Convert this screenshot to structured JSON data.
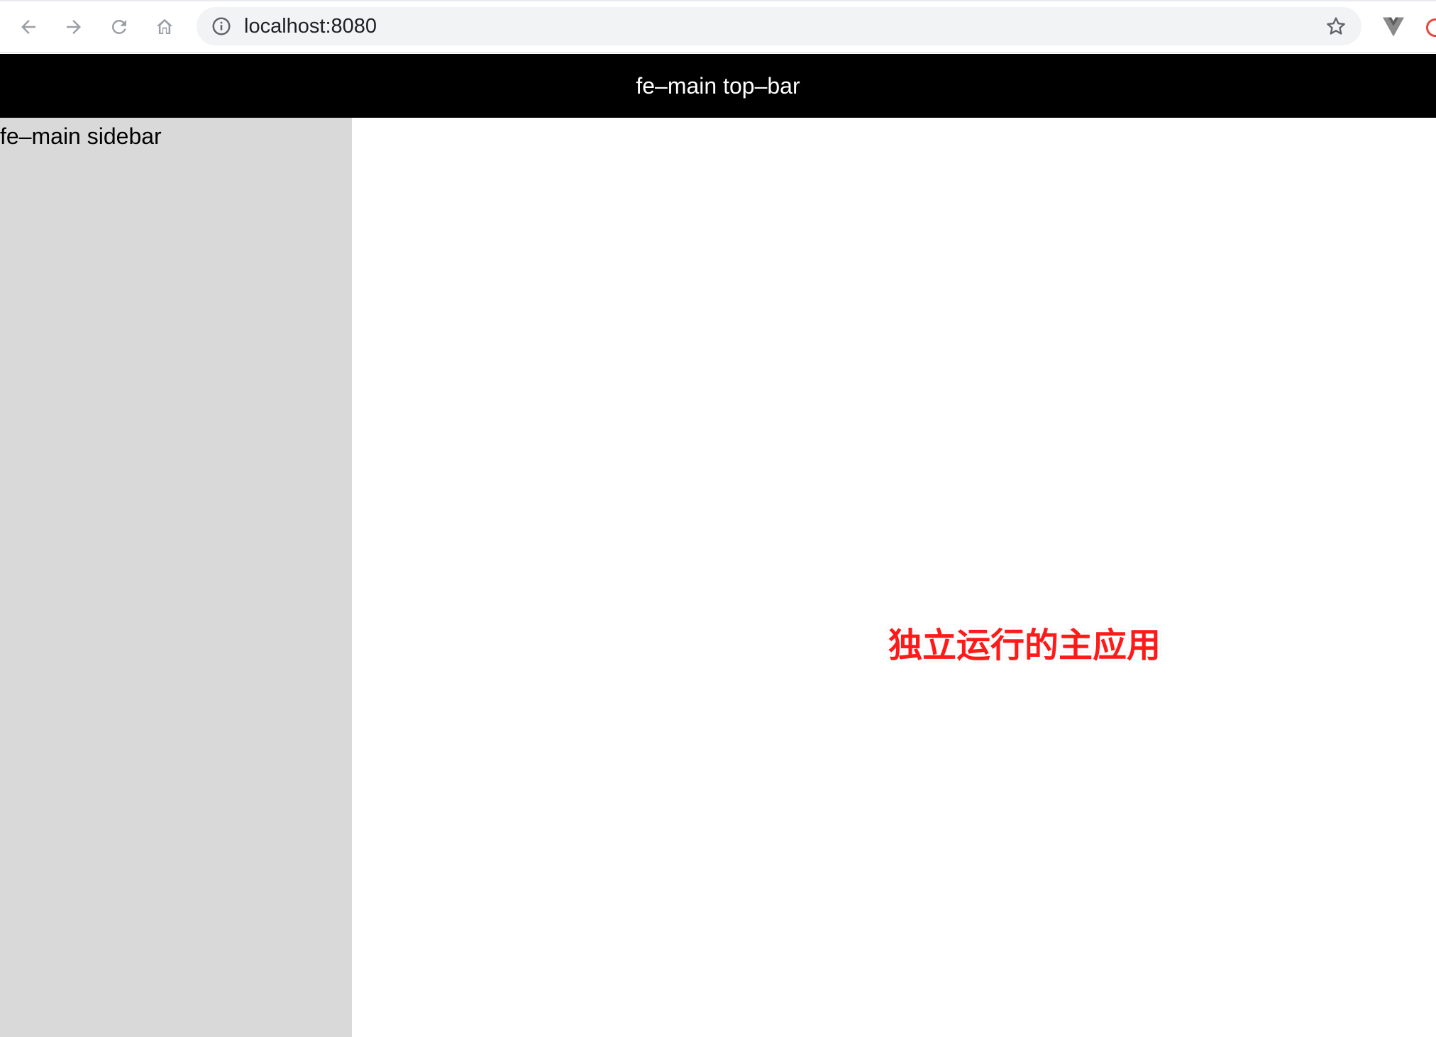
{
  "browser": {
    "url": "localhost:8080",
    "icons": [
      "back-arrow-icon",
      "forward-arrow-icon",
      "reload-icon",
      "home-icon",
      "site-info-icon",
      "bookmark-star-icon",
      "vue-devtools-extension-icon"
    ],
    "colors": {
      "toolbar_bg": "#ffffff",
      "omnibox_bg": "#f1f3f4",
      "icon": "#5f6368"
    }
  },
  "app": {
    "top_bar": {
      "title": "fe–main top–bar",
      "bg": "#000000",
      "color": "#ffffff"
    },
    "sidebar": {
      "title": "fe–main sidebar",
      "bg": "#d9d9d9"
    },
    "main": {
      "bg": "#ffffff"
    }
  },
  "annotation": {
    "text": "独立运行的主应用",
    "color": "#ff1a1a"
  }
}
